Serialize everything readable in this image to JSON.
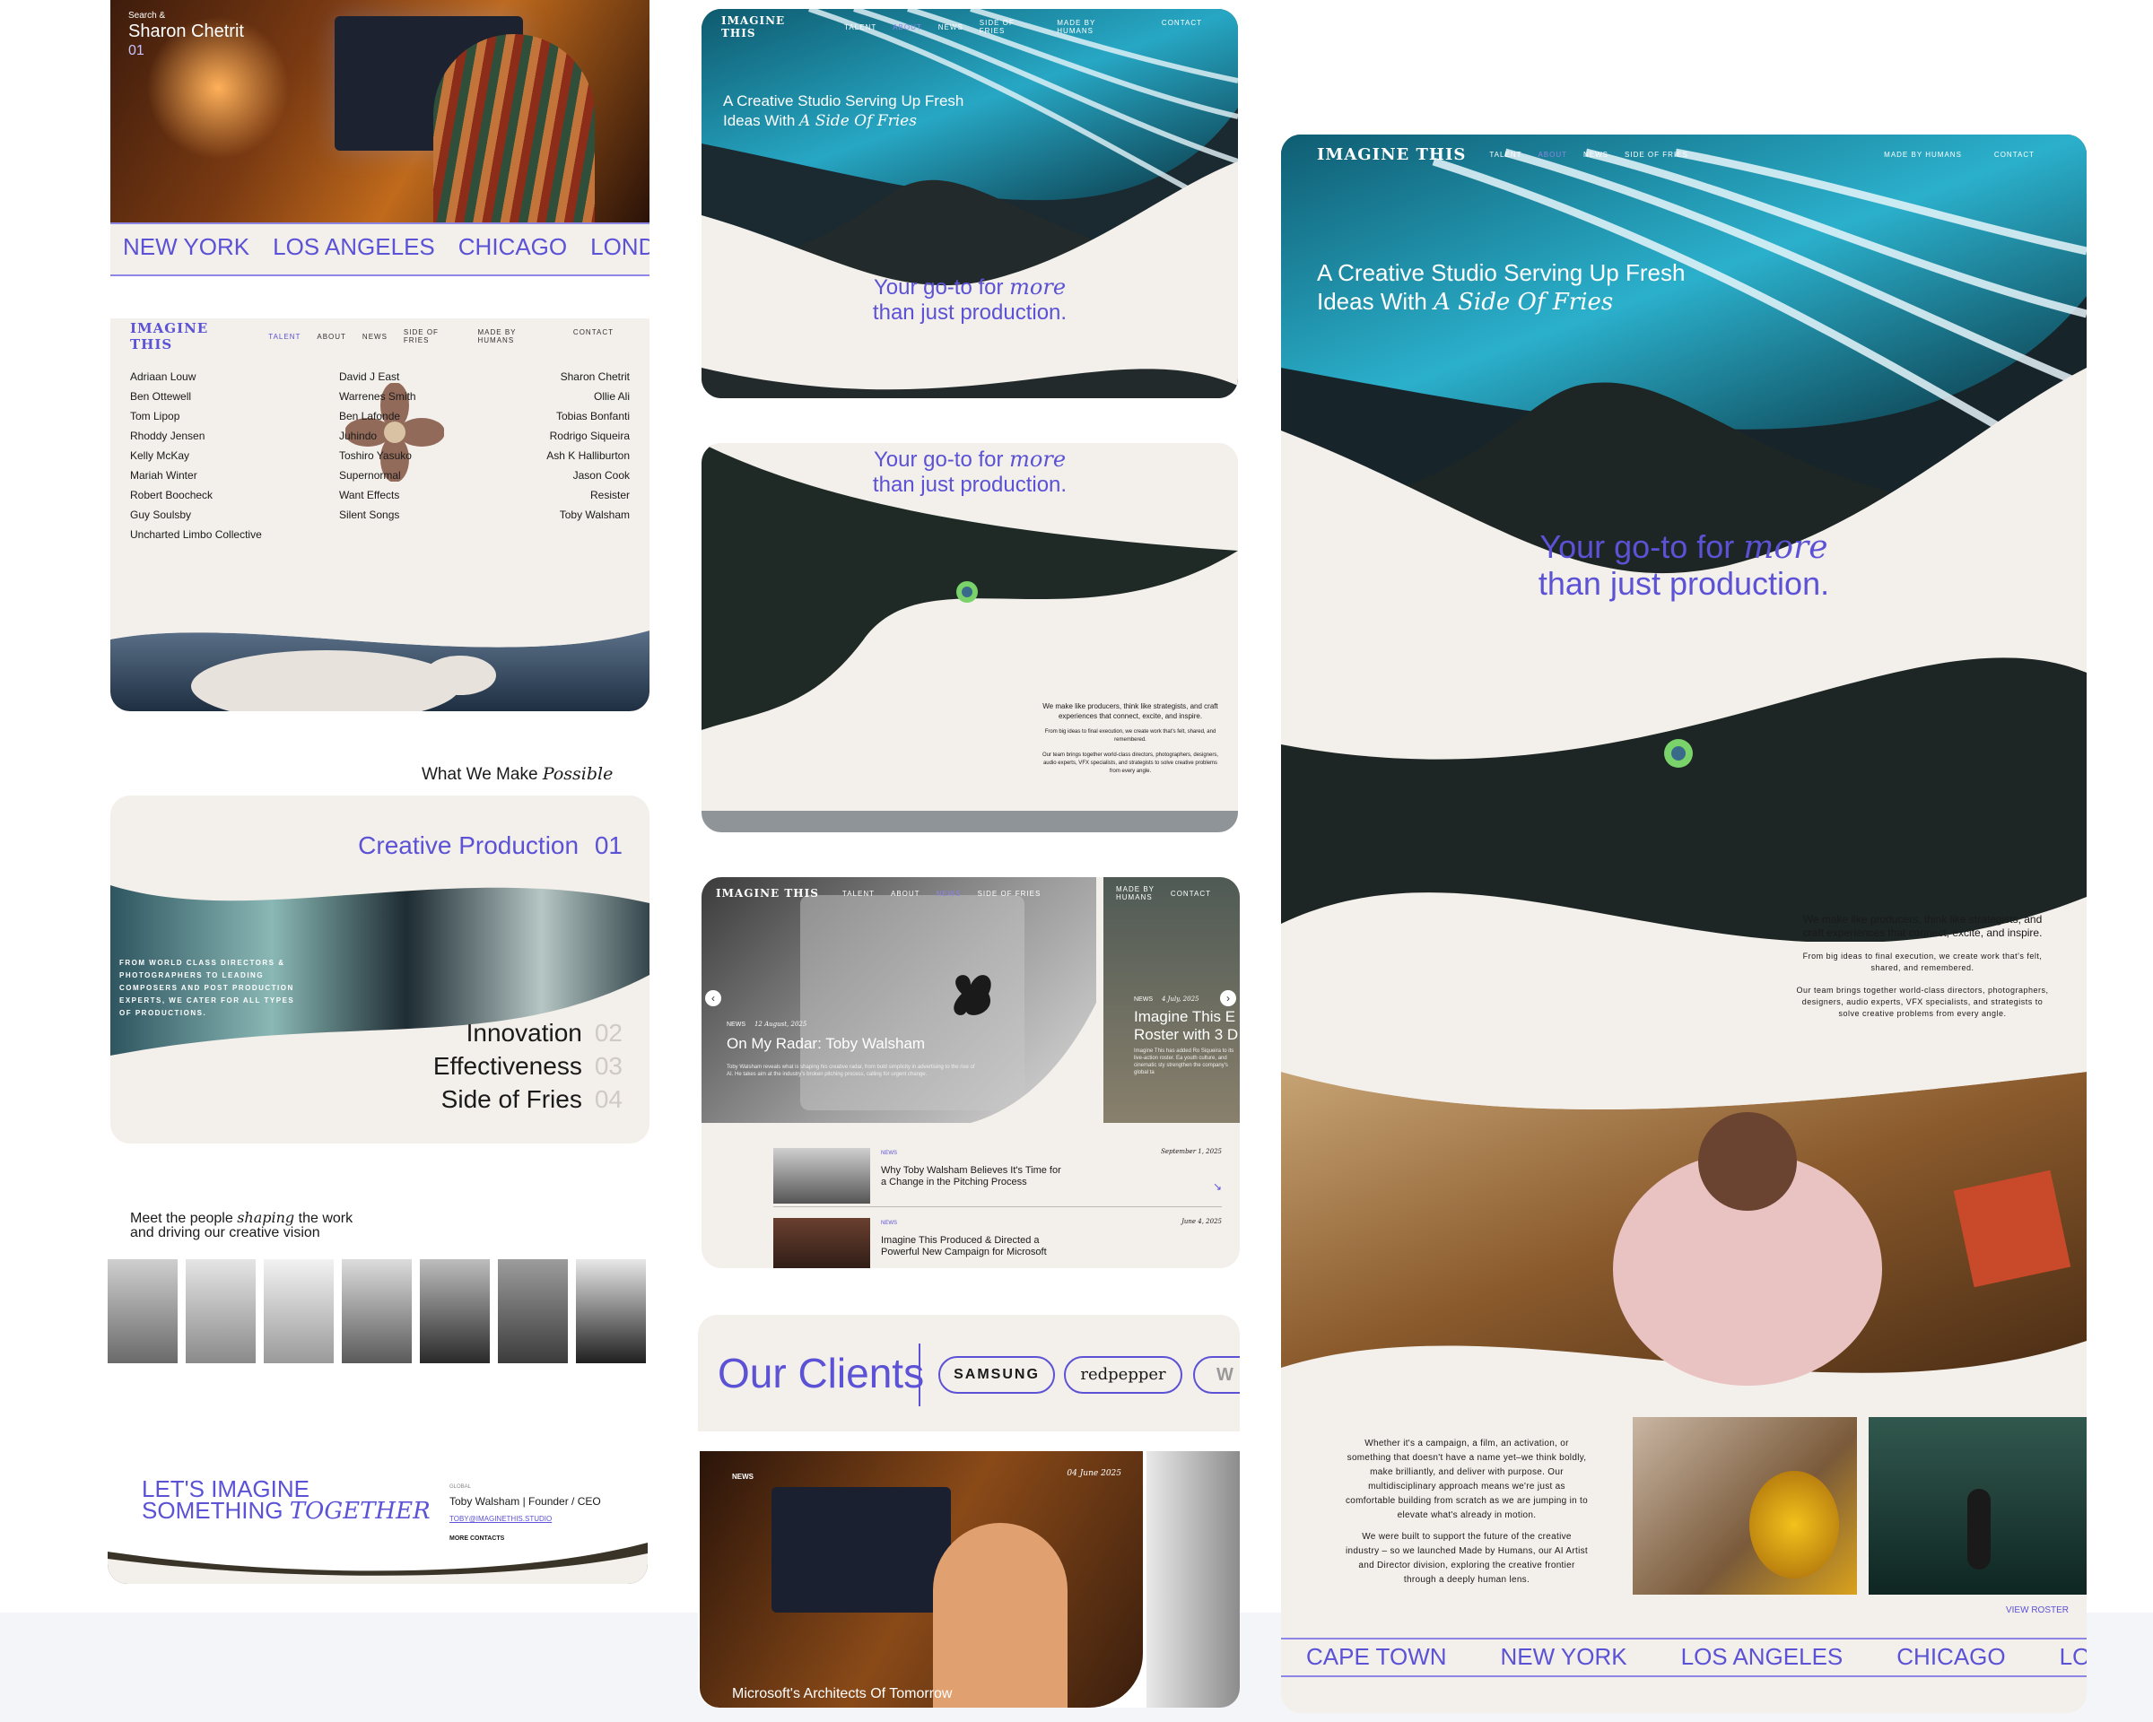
{
  "colors": {
    "accent": "#5b52d6",
    "cream": "#f3efea",
    "dark": "#13161a"
  },
  "nav": {
    "logo": "IMAGINE THIS",
    "talent": "TALENT",
    "about": "ABOUT",
    "news": "NEWS",
    "side_of_fries": "SIDE OF FRIES",
    "made_by_humans": "MADE BY HUMANS",
    "contact": "CONTACT"
  },
  "hero": {
    "line1": "A Creative Studio Serving Up Fresh",
    "line2_pre": "Ideas With",
    "line2_italic": "A Side Of Fries"
  },
  "tagline": {
    "pre": "Your go-to for",
    "italic": "more",
    "line2": "than just production."
  },
  "intro": {
    "lead": "We make like producers, think like strategists, and craft experiences that connect, excite, and inspire.",
    "p1": "From big ideas to final execution, we create work that's felt, shared, and remembered.",
    "p2": "Our team brings together world-class directors, photographers, designers, audio experts, VFX specialists, and strategists to solve creative problems from every angle."
  },
  "video_card": {
    "caption": "Search &",
    "name": "Sharon Chetrit",
    "num": "01"
  },
  "cities_top": [
    "NEW YORK",
    "LOS ANGELES",
    "CHICAGO",
    "LONDON"
  ],
  "cities_bottom": [
    "CAPE TOWN",
    "NEW YORK",
    "LOS ANGELES",
    "CHICAGO",
    "LONDON"
  ],
  "talent": {
    "col1": [
      "Adriaan Louw",
      "Ben Ottewell",
      "Tom Lipop",
      "Rhoddy Jensen",
      "Kelly McKay",
      "Mariah Winter",
      "Robert Boocheck",
      "Guy Soulsby",
      "Uncharted Limbo Collective"
    ],
    "col2": [
      "David J East",
      "Warrenes Smith",
      "Ben Lafonde",
      "Juhindo",
      "Toshiro Yasuko",
      "Supernormal",
      "Want Effects",
      "Silent Songs"
    ],
    "col3": [
      "Sharon Chetrit",
      "Ollie Ali",
      "Tobias Bonfanti",
      "Rodrigo Siqueira",
      "Ash K Halliburton",
      "Jason Cook",
      "Resister",
      "Toby Walsham"
    ]
  },
  "services": {
    "heading_pre": "What We Make",
    "heading_italic": "Possible",
    "active": "Creative Production",
    "active_num": "01",
    "blurb": "FROM WORLD CLASS DIRECTORS & PHOTOGRAPHERS TO LEADING COMPOSERS AND POST PRODUCTION EXPERTS, WE CATER FOR ALL TYPES OF PRODUCTIONS.",
    "items": [
      {
        "label": "Innovation",
        "num": "02"
      },
      {
        "label": "Effectiveness",
        "num": "03"
      },
      {
        "label": "Side of Fries",
        "num": "04"
      }
    ]
  },
  "people": {
    "pre": "Meet the people",
    "italic": "shaping",
    "post": "the work",
    "line2": "and driving our creative vision"
  },
  "cta": {
    "line1": "LET'S IMAGINE",
    "line2_pre": "SOMETHING",
    "line2_italic": "TOGETHER",
    "role_label": "GLOBAL",
    "person": "Toby Walsham | Founder / CEO",
    "email": "TOBY@IMAGINETHIS.STUDIO",
    "more": "MORE CONTACTS"
  },
  "news_slider": {
    "main": {
      "tag": "NEWS",
      "date": "12 August, 2025",
      "title": "On My Radar: Toby Walsham",
      "body": "Toby Walsham reveals what is shaping his creative radar, from bold simplicity in advertising to the rise of AI. He takes aim at the industry's broken pitching process, calling for urgent change."
    },
    "side": {
      "tag": "NEWS",
      "date": "4 July, 2025",
      "title_l1": "Imagine This E",
      "title_l2": "Roster with 3 D",
      "body": "Imagine This has added Ro Siqueira to its live-action roster. Ea youth culture, and cinematic sty strengthen the company's global ta"
    },
    "list": [
      {
        "tag": "NEWS",
        "date": "September 1, 2025",
        "title_l1": "Why Toby Walsham Believes It's Time for",
        "title_l2": "a Change in the Pitching Process"
      },
      {
        "tag": "NEWS",
        "date": "June 4, 2025",
        "title_l1": "Imagine This Produced & Directed a",
        "title_l2": "Powerful New Campaign for Microsoft"
      }
    ]
  },
  "clients": {
    "heading": "Our Clients",
    "logos": [
      "SAMSUNG",
      "redpepper",
      "W"
    ]
  },
  "news_card": {
    "tag": "NEWS",
    "date": "04 June 2025",
    "title": "Microsoft's Architects Of Tomorrow"
  },
  "about": {
    "p1": "Whether it's a campaign, a film, an activation, or something that doesn't have a name yet–we think boldly, make brilliantly, and deliver with purpose. Our multidisciplinary approach means we're just as comfortable building from scratch as we are jumping in to elevate what's already in motion.",
    "p2": "We were built to support the future of the creative industry – so we launched Made by Humans, our AI Artist and Director division, exploring the creative frontier through a deeply human lens.",
    "roster_link": "VIEW ROSTER"
  }
}
